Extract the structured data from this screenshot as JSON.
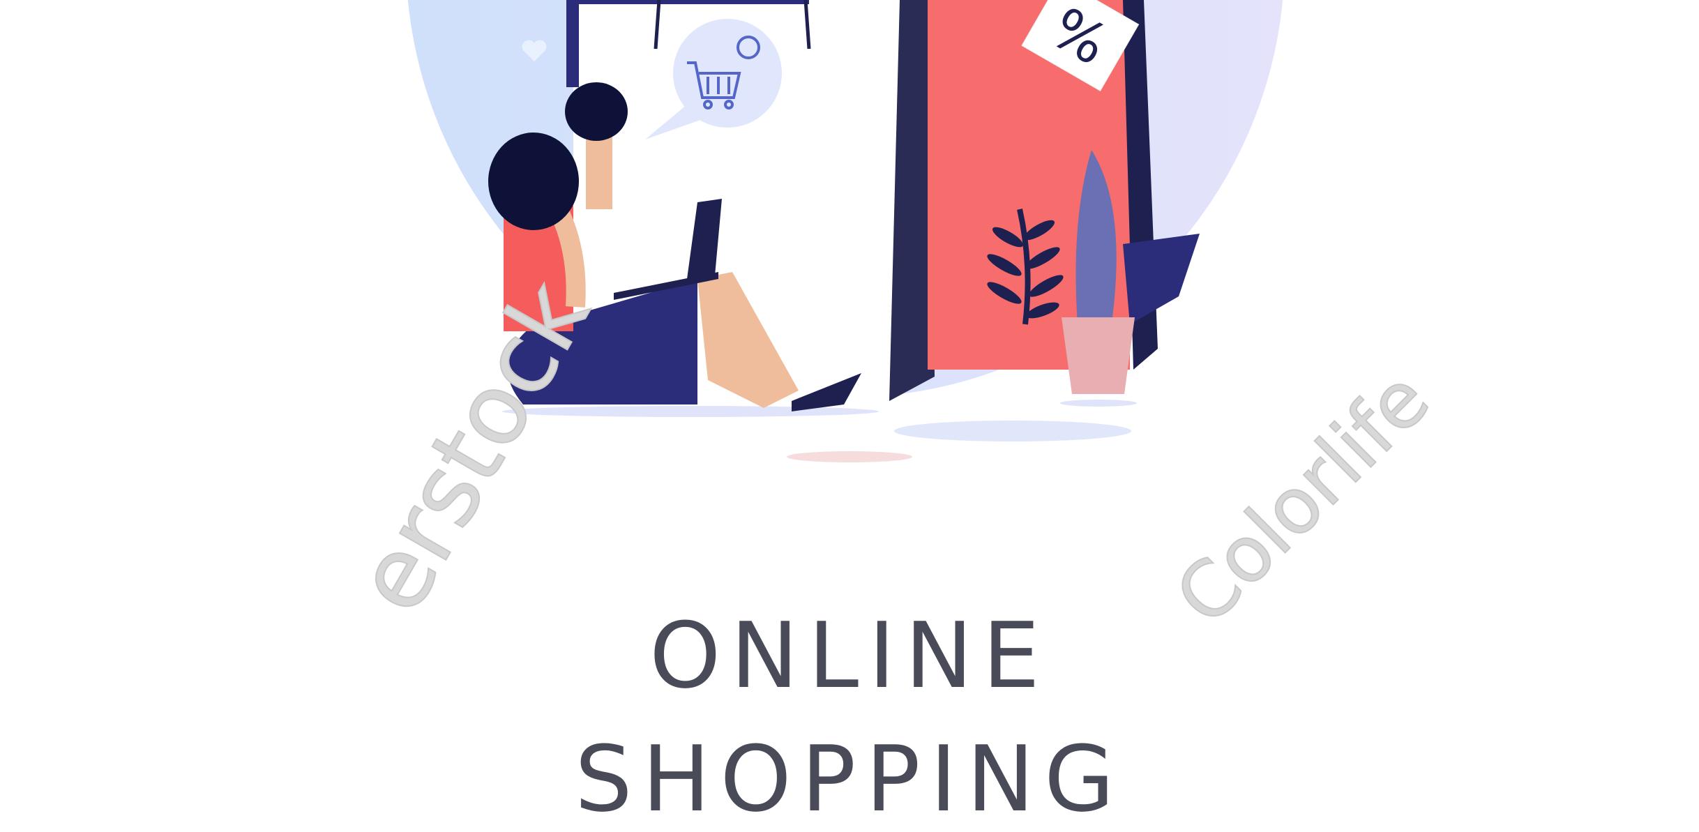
{
  "headline": {
    "line1": "ONLINE",
    "line2": "SHOPPING"
  },
  "discount_tag": "%",
  "watermarks": [
    "Colorlife",
    "erstock"
  ],
  "colors": {
    "circle_left": "#cfe0fb",
    "circle_right": "#e3e3fb",
    "door": "#f76d6d",
    "navy": "#1e2050",
    "skirt": "#2c2d7a",
    "text": "#4a4b58"
  }
}
